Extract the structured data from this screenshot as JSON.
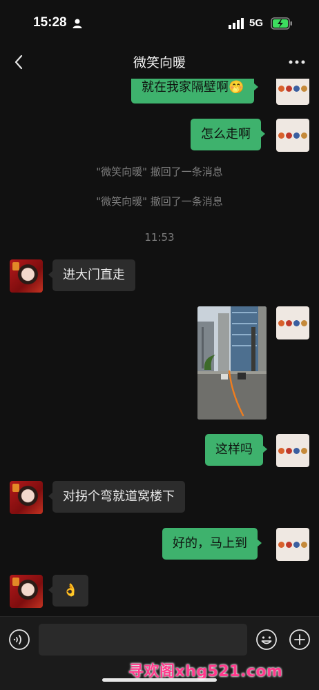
{
  "status_bar": {
    "time": "15:28",
    "network": "5G"
  },
  "nav": {
    "title": "微笑向暖"
  },
  "messages": {
    "me_1": "就在我家隔壁啊",
    "me_1_emoji": "🤭",
    "me_2": "怎么走啊",
    "recall_1": "\"微笑向暖\" 撤回了一条消息",
    "recall_2": "\"微笑向暖\" 撤回了一条消息",
    "time": "11:53",
    "friend_1": "进大门直走",
    "me_3": "这样吗",
    "friend_2": "对拐个弯就道窝楼下",
    "me_4": "好的，马上到",
    "friend_3": "👌"
  },
  "watermark": "寻欢阁xhg521.com",
  "colors": {
    "bubble_me": "#3eb26d",
    "bubble_friend": "#2c2c2c",
    "background": "#111111"
  }
}
